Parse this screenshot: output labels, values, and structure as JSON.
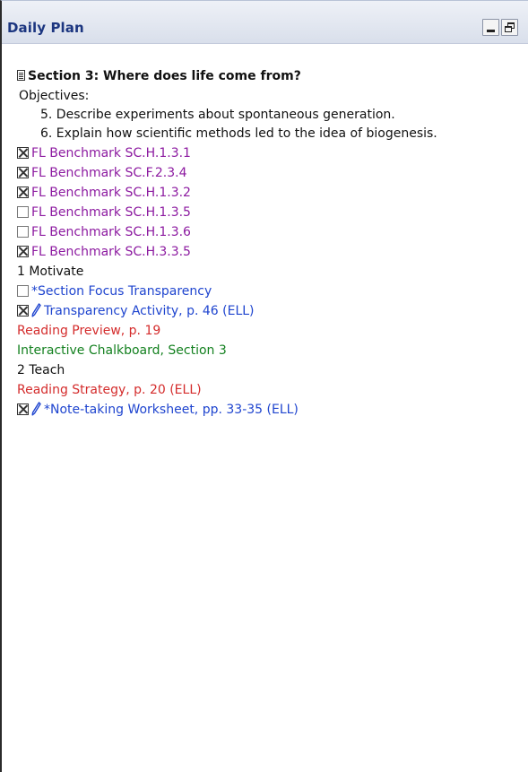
{
  "window": {
    "title": "Daily Plan"
  },
  "plan": {
    "section_title": "Section 3: Where does life come from?",
    "objectives_label": "Objectives:",
    "objectives": [
      "5. Describe experiments about spontaneous generation.",
      "6. Explain how scientific methods led to the idea of biogenesis."
    ],
    "benchmarks": [
      {
        "label": "FL Benchmark SC.H.1.3.1",
        "checked": true
      },
      {
        "label": "FL Benchmark SC.F.2.3.4",
        "checked": true
      },
      {
        "label": "FL Benchmark SC.H.1.3.2",
        "checked": true
      },
      {
        "label": "FL Benchmark SC.H.1.3.5",
        "checked": false
      },
      {
        "label": "FL Benchmark SC.H.1.3.6",
        "checked": false
      },
      {
        "label": "FL Benchmark SC.H.3.3.5",
        "checked": true
      }
    ],
    "motivate": {
      "heading": "1 Motivate",
      "items": [
        {
          "label": "*Section Focus Transparency",
          "checked": false
        },
        {
          "label": "Transparency Activity, p. 46 (ELL)",
          "checked": true,
          "icon": "pencil-icon"
        }
      ],
      "reading_preview": "Reading Preview, p. 19",
      "chalkboard": "Interactive Chalkboard, Section 3"
    },
    "teach": {
      "heading": "2 Teach",
      "reading_strategy": "Reading Strategy, p. 20 (ELL)",
      "items": [
        {
          "label": "*Note-taking Worksheet, pp. 33-35 (ELL)",
          "checked": true,
          "icon": "pencil-icon"
        }
      ]
    }
  },
  "colors": {
    "title": "#1c3680",
    "benchmark": "#8c1aa0",
    "resource_link": "#1f45cf",
    "reading": "#d42c2c",
    "interactive": "#13801f"
  }
}
